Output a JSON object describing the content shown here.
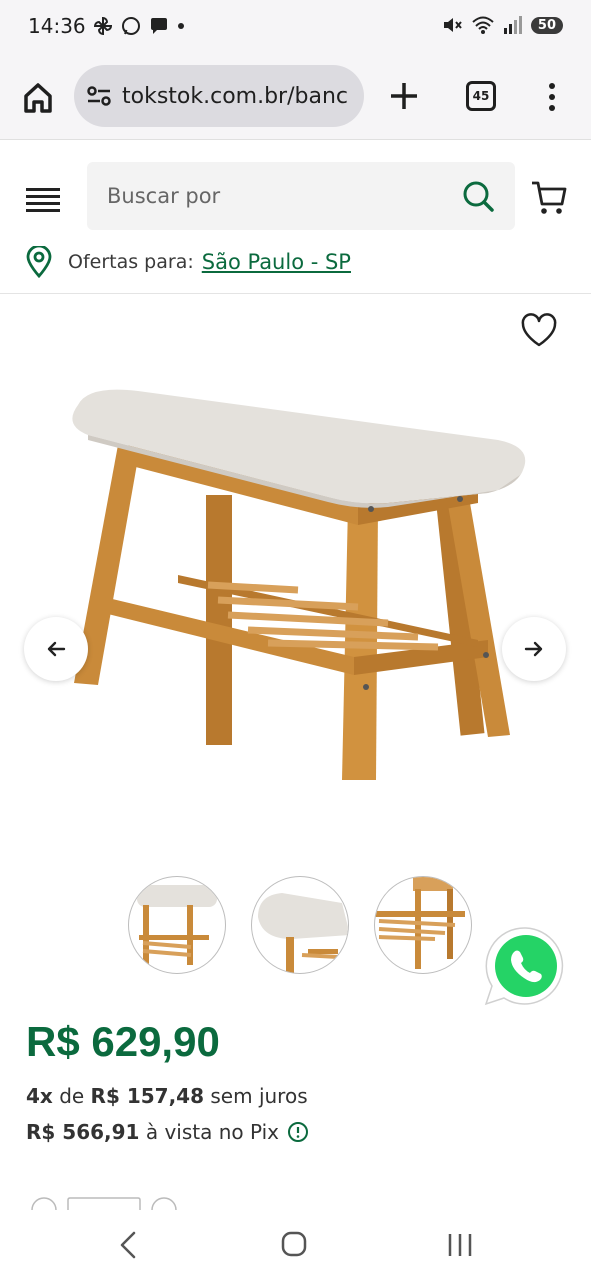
{
  "status_bar": {
    "time": "14:36",
    "battery": "50",
    "notification_icons": [
      "pinwheel-icon",
      "whatsapp-icon",
      "chat-icon",
      "dot-icon"
    ],
    "system_icons": [
      "mute-icon",
      "wifi-icon",
      "signal-icon",
      "battery-icon"
    ]
  },
  "browser": {
    "url": "tokstok.com.br/banc",
    "tab_count": "45"
  },
  "header": {
    "search_placeholder": "Buscar por",
    "location_label": "Ofertas para:",
    "location_value": "São Paulo - SP"
  },
  "product": {
    "price": "R$ 629,90",
    "installments_count": "4x",
    "installments_de": "de",
    "installments_value": "R$ 157,48",
    "installments_suffix": "sem juros",
    "pix_price": "R$ 566,91",
    "pix_suffix": "à vista no Pix"
  },
  "colors": {
    "brand_green": "#0b6a3e",
    "whatsapp_green": "#25d366",
    "wood": "#c98a3a",
    "cushion": "#e4e1dc"
  }
}
